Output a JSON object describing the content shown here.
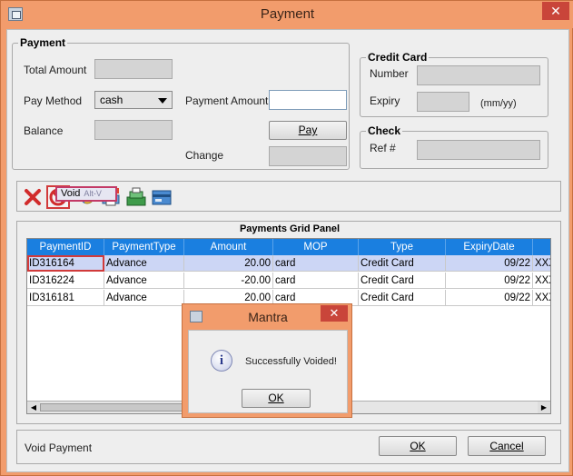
{
  "window": {
    "title": "Payment",
    "close_glyph": "✕"
  },
  "payment_group": {
    "title": "Payment",
    "total_amount_label": "Total Amount",
    "pay_method_label": "Pay Method",
    "pay_method_value": "cash",
    "payment_amount_label": "Payment Amount",
    "balance_label": "Balance",
    "pay_button": "Pay",
    "change_label": "Change"
  },
  "credit_card_group": {
    "title": "Credit Card",
    "number_label": "Number",
    "expiry_label": "Expiry",
    "expiry_hint": "(mm/yy)"
  },
  "check_group": {
    "title": "Check",
    "ref_label": "Ref #"
  },
  "toolbar": {
    "icons": [
      "delete-icon",
      "void-icon",
      "refund-icon",
      "print-icon",
      "cash-register-icon",
      "card-terminal-icon"
    ],
    "tooltip_label": "Void",
    "tooltip_accelerator": "Alt-V"
  },
  "grid": {
    "title": "Payments Grid Panel",
    "columns": [
      "PaymentID",
      "PaymentType",
      "Amount",
      "MOP",
      "Type",
      "ExpiryDate",
      ""
    ],
    "rows": [
      {
        "id": "ID316164",
        "type": "Advance",
        "amount": "20.00",
        "mop": "card",
        "card_type": "Credit Card",
        "expiry": "09/22",
        "extra": "XXX"
      },
      {
        "id": "ID316224",
        "type": "Advance",
        "amount": "-20.00",
        "mop": "card",
        "card_type": "Credit Card",
        "expiry": "09/22",
        "extra": "XXX"
      },
      {
        "id": "ID316181",
        "type": "Advance",
        "amount": "20.00",
        "mop": "card",
        "card_type": "Credit Card",
        "expiry": "09/22",
        "extra": "XXX"
      }
    ],
    "scroll_left_glyph": "◀",
    "scroll_right_glyph": "▶"
  },
  "status": {
    "text": "Void Payment",
    "ok_button": "OK",
    "cancel_button": "Cancel"
  },
  "dialog": {
    "title": "Mantra",
    "close_glyph": "✕",
    "info_glyph": "i",
    "message": "Successfully Voided!",
    "ok_button": "OK"
  },
  "colors": {
    "title_bar": "#f29c6c",
    "grid_header": "#1a7fe0",
    "selected_row": "#ccd6f5",
    "focus_border": "#d13a3a",
    "close_button": "#c9453a"
  }
}
